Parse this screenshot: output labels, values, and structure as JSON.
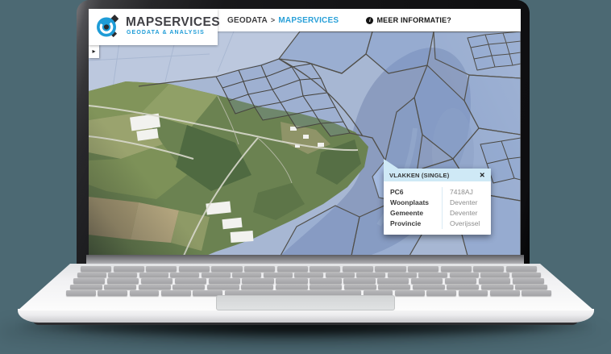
{
  "page": {
    "background_color": "#4c6973",
    "device": "laptop-mockup"
  },
  "app": {
    "logo": {
      "title": "MAPSERVICES",
      "subtitle": "GEODATA & ANALYSIS",
      "icon": "mapservices-globe-icon",
      "accent_color": "#1e9cd7"
    },
    "header": {
      "breadcrumb": {
        "root": "GEODATA",
        "separator": ">",
        "current": "MAPSERVICES"
      },
      "info_link": {
        "icon": "info-circle-icon",
        "icon_glyph": "i",
        "label": "MEER INFORMATIE?"
      }
    },
    "sidebar_toggle": {
      "icon": "chevron-right-icon",
      "glyph": "▸"
    },
    "map": {
      "type": "aerial-with-cadastral-overlay",
      "overlay_fill": "#7e9ccd",
      "parcel_outline": "#514f49",
      "land_color": "#6b8251",
      "water_color": "#8b9cbf"
    },
    "popup": {
      "title": "VLAKKEN (SINGLE)",
      "close_glyph": "✕",
      "header_bg": "#cfe9f6",
      "rows": [
        {
          "label": "PC6",
          "value": "7418AJ"
        },
        {
          "label": "Woonplaats",
          "value": "Deventer"
        },
        {
          "label": "Gemeente",
          "value": "Deventer"
        },
        {
          "label": "Provincie",
          "value": "Overijssel"
        }
      ]
    }
  }
}
